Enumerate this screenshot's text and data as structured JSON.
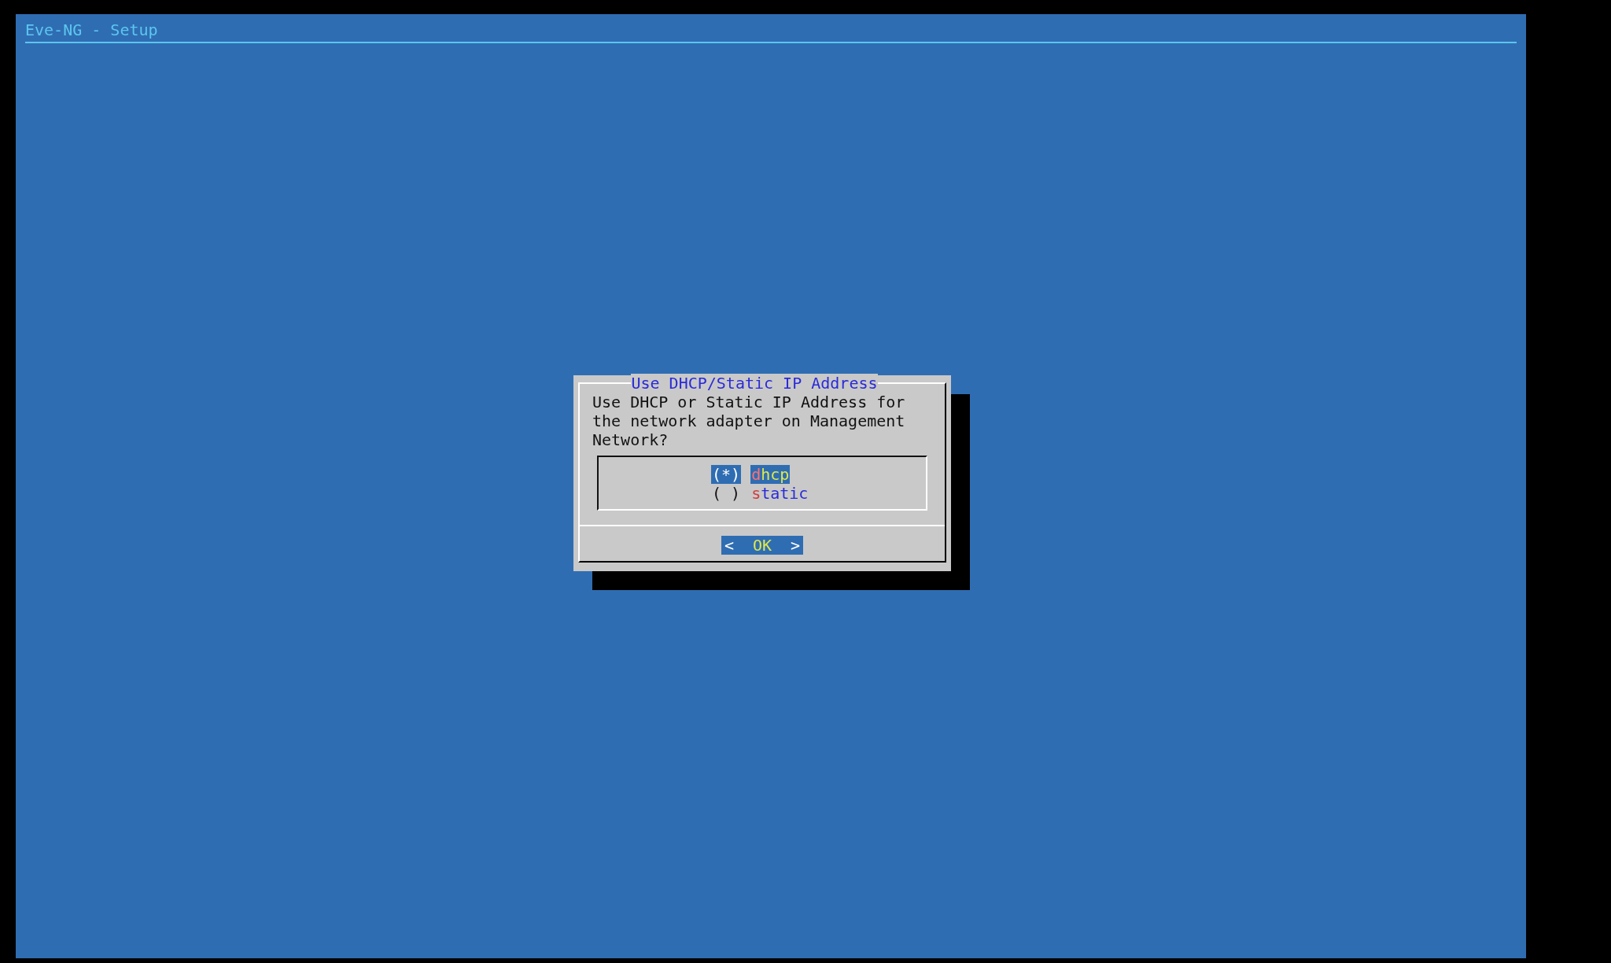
{
  "screen": {
    "title": "Eve-NG - Setup"
  },
  "dialog": {
    "title": "Use DHCP/Static IP Address",
    "message_lines": [
      "Use DHCP or Static IP Address for",
      "the network adapter on Management",
      "Network?"
    ],
    "options": [
      {
        "marker": "(*)",
        "label": "dhcp",
        "selected": true
      },
      {
        "marker": "( )",
        "label": "static",
        "selected": false
      }
    ],
    "button": {
      "left": "<",
      "label": "OK",
      "right": ">",
      "selected": true
    }
  }
}
